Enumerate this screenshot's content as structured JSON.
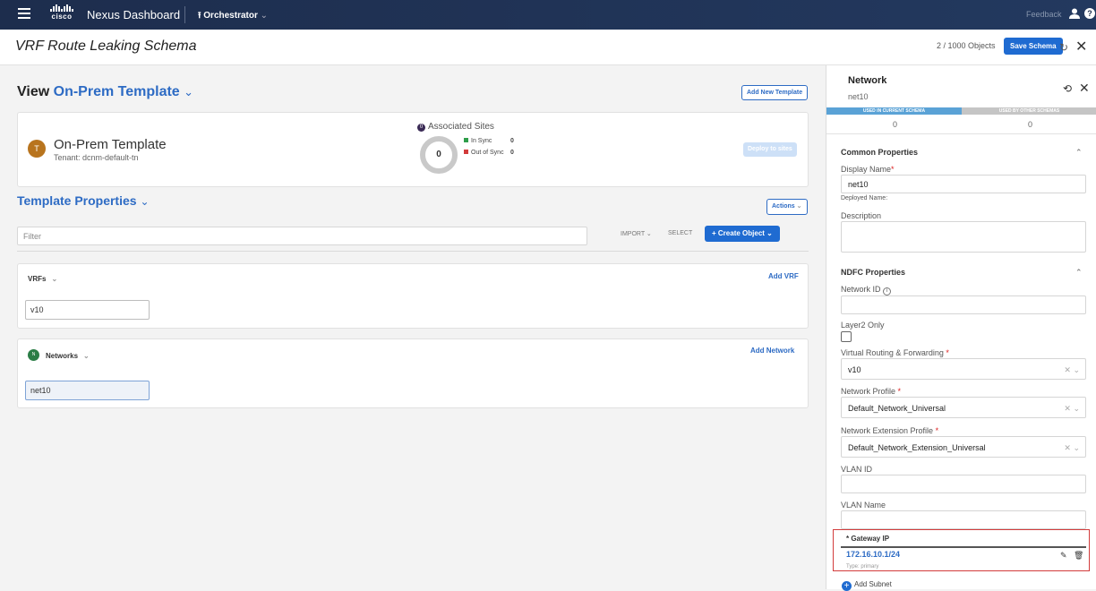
{
  "topbar": {
    "logo_text": "cisco",
    "app_name": "Nexus Dashboard",
    "service": "Orchestrator",
    "feedback": "Feedback",
    "help_icon": "?"
  },
  "header": {
    "title": "VRF Route Leaking Schema",
    "objects": "2 / 1000 Objects",
    "save_label": "Save Schema"
  },
  "view": {
    "prefix": "View",
    "template_name": "On-Prem Template",
    "add_template_label": "Add New Template"
  },
  "template_card": {
    "avatar": "T",
    "name": "On-Prem Template",
    "tenant": "Tenant: dcnm-default-tn",
    "associated_count_badge": "0",
    "associated_label": "Associated Sites",
    "donut_value": "0",
    "in_sync_label": "In Sync",
    "in_sync_value": "0",
    "out_of_sync_label": "Out of Sync",
    "out_of_sync_value": "0",
    "deploy_label": "Deploy to sites",
    "in_sync_color": "#2e9d4a",
    "out_of_sync_color": "#d23b3b"
  },
  "template_properties": {
    "title": "Template Properties",
    "actions_label": "Actions",
    "filter_placeholder": "Filter",
    "import_label": "IMPORT",
    "select_label": "SELECT",
    "create_label": "Create Object"
  },
  "vrfs": {
    "label": "VRFs",
    "add_label": "Add VRF",
    "items": [
      "v10"
    ]
  },
  "networks": {
    "avatar": "N",
    "label": "Networks",
    "add_label": "Add Network",
    "items": [
      "net10"
    ]
  },
  "panel": {
    "title": "Network",
    "subtitle": "net10",
    "used_current": "USED IN CURRENT SCHEMA",
    "used_other": "USED BY OTHER SCHEMAS",
    "count_current": "0",
    "count_other": "0",
    "common": {
      "title": "Common Properties",
      "display_name_label": "Display Name",
      "display_name_value": "net10",
      "deployed_name_label": "Deployed Name:",
      "description_label": "Description"
    },
    "ndfc": {
      "title": "NDFC Properties",
      "network_id_label": "Network ID",
      "layer2_label": "Layer2 Only",
      "vrf_label": "Virtual Routing & Forwarding",
      "vrf_value": "v10",
      "profile_label": "Network Profile",
      "profile_value": "Default_Network_Universal",
      "ext_profile_label": "Network Extension Profile",
      "ext_profile_value": "Default_Network_Extension_Universal",
      "vlan_id_label": "VLAN ID",
      "vlan_name_label": "VLAN Name"
    },
    "gateway": {
      "title": "* Gateway IP",
      "value": "172.16.10.1/24",
      "type": "Type: primary"
    },
    "add_subnet_label": "Add Subnet"
  }
}
